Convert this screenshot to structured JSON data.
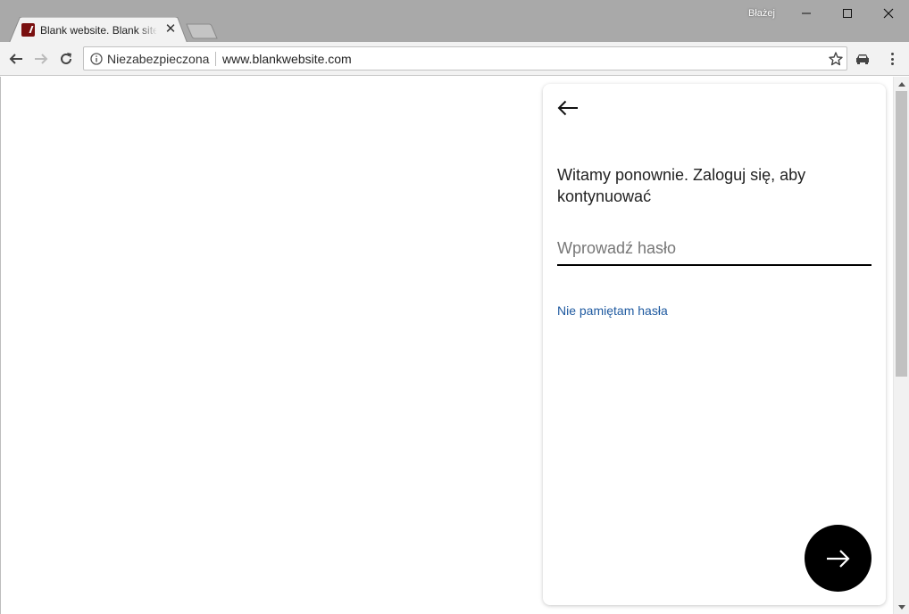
{
  "window": {
    "user_name": "Błażej",
    "minimize_icon": "minimize-icon",
    "maximize_icon": "maximize-icon",
    "close_icon": "window-close-icon"
  },
  "tab": {
    "title": "Blank website. Blank site.",
    "favicon": "site-favicon",
    "favicon_color": "#7a1010",
    "close_icon": "close-icon"
  },
  "toolbar": {
    "back_icon": "arrow-left-icon",
    "forward_icon": "arrow-right-icon",
    "reload_icon": "reload-icon",
    "security_label": "Niezabezpieczona",
    "url": "www.blankwebsite.com",
    "bookmark_icon": "star-icon",
    "extension_icon": "car-icon",
    "menu_icon": "kebab-menu-icon"
  },
  "login": {
    "back_icon": "arrow-left-icon",
    "heading": "Witamy ponownie. Zaloguj się, aby kontynuować",
    "password_placeholder": "Wprowadź hasło",
    "password_value": "",
    "forgot_link": "Nie pamiętam hasła",
    "next_icon": "arrow-right-icon",
    "link_color": "#1f5aa0",
    "button_color": "#000000"
  }
}
